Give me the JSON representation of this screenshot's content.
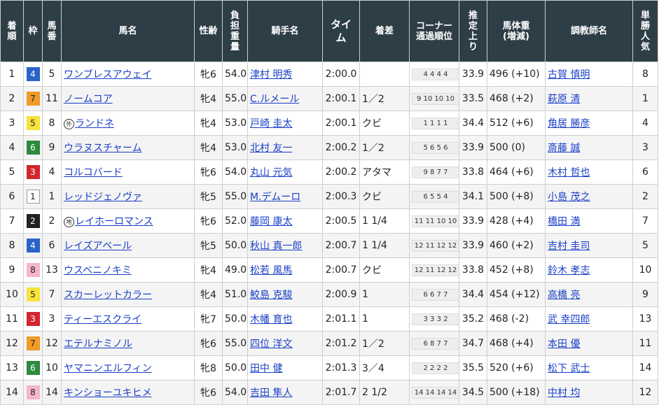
{
  "headers": {
    "rank": "着順",
    "waku": "枠",
    "umaban": "馬番",
    "horse": "馬名",
    "sexage": "性齢",
    "weight": "負担重量",
    "jockey": "騎手名",
    "time": "タイム",
    "margin": "着差",
    "corner": "コーナー通過順位",
    "last3f": "推定上り",
    "body": "馬体重(増減)",
    "trainer": "調教師名",
    "pop": "単勝人気"
  },
  "waku_colors": {
    "1": {
      "bg": "#ffffff",
      "fg": "#222222"
    },
    "2": {
      "bg": "#222222",
      "fg": "#ffffff"
    },
    "3": {
      "bg": "#d0262d",
      "fg": "#ffffff"
    },
    "4": {
      "bg": "#2a64c8",
      "fg": "#ffffff"
    },
    "5": {
      "bg": "#f6e33b",
      "fg": "#222222"
    },
    "6": {
      "bg": "#2e8a3e",
      "fg": "#ffffff"
    },
    "7": {
      "bg": "#f09a28",
      "fg": "#222222"
    },
    "8": {
      "bg": "#f6b6c8",
      "fg": "#222222"
    }
  },
  "rows": [
    {
      "rank": "1",
      "waku": "4",
      "umaban": "5",
      "mark": "",
      "horse": "ワンブレスアウェイ",
      "sexage": "牝6",
      "weight": "54.0",
      "jockey": "津村 明秀",
      "time": "2:00.0",
      "margin": "",
      "corner": "4 4 4 4",
      "last3f": "33.9",
      "body": "496 (+10)",
      "trainer": "古賀 慎明",
      "pop": "8"
    },
    {
      "rank": "2",
      "waku": "7",
      "umaban": "11",
      "mark": "",
      "horse": "ノームコア",
      "sexage": "牝4",
      "weight": "55.0",
      "jockey": "C.ルメール",
      "time": "2:00.1",
      "margin": "1／2",
      "corner": "9 10 10 10",
      "last3f": "33.5",
      "body": "468 (+2)",
      "trainer": "萩原 清",
      "pop": "1"
    },
    {
      "rank": "3",
      "waku": "5",
      "umaban": "8",
      "mark": "外",
      "horse": "ランドネ",
      "sexage": "牝4",
      "weight": "53.0",
      "jockey": "戸崎 圭太",
      "time": "2:00.1",
      "margin": "クビ",
      "corner": "1 1 1 1",
      "last3f": "34.4",
      "body": "512 (+6)",
      "trainer": "角居 勝彦",
      "pop": "4"
    },
    {
      "rank": "4",
      "waku": "6",
      "umaban": "9",
      "mark": "",
      "horse": "ウラヌスチャーム",
      "sexage": "牝4",
      "weight": "53.0",
      "jockey": "北村 友一",
      "time": "2:00.2",
      "margin": "1／2",
      "corner": "5 6 5 6",
      "last3f": "33.9",
      "body": "500 (0)",
      "trainer": "斎藤 誠",
      "pop": "3"
    },
    {
      "rank": "5",
      "waku": "3",
      "umaban": "4",
      "mark": "",
      "horse": "コルコバード",
      "sexage": "牝6",
      "weight": "54.0",
      "jockey": "丸山 元気",
      "time": "2:00.2",
      "margin": "アタマ",
      "corner": "9 8 7 7",
      "last3f": "33.8",
      "body": "464 (+6)",
      "trainer": "木村 哲也",
      "pop": "6"
    },
    {
      "rank": "6",
      "waku": "1",
      "umaban": "1",
      "mark": "",
      "horse": "レッドジェノヴァ",
      "sexage": "牝5",
      "weight": "55.0",
      "jockey": "M.デムーロ",
      "time": "2:00.3",
      "margin": "クビ",
      "corner": "6 5 5 4",
      "last3f": "34.1",
      "body": "500 (+8)",
      "trainer": "小島 茂之",
      "pop": "2"
    },
    {
      "rank": "7",
      "waku": "2",
      "umaban": "2",
      "mark": "地",
      "horse": "レイホーロマンス",
      "sexage": "牝6",
      "weight": "52.0",
      "jockey": "藤岡 康太",
      "time": "2:00.5",
      "margin": "1 1/4",
      "corner": "11 11 10 10",
      "last3f": "33.9",
      "body": "428 (+4)",
      "trainer": "橋田 満",
      "pop": "7"
    },
    {
      "rank": "8",
      "waku": "4",
      "umaban": "6",
      "mark": "",
      "horse": "レイズアベール",
      "sexage": "牝5",
      "weight": "50.0",
      "jockey": "秋山 真一郎",
      "time": "2:00.7",
      "margin": "1 1/4",
      "corner": "12 11 12 12",
      "last3f": "33.9",
      "body": "460 (+2)",
      "trainer": "吉村 圭司",
      "pop": "5"
    },
    {
      "rank": "9",
      "waku": "8",
      "umaban": "13",
      "mark": "",
      "horse": "ウスベニノキミ",
      "sexage": "牝4",
      "weight": "49.0",
      "jockey": "松若 風馬",
      "time": "2:00.7",
      "margin": "クビ",
      "corner": "12 11 12 12",
      "last3f": "33.8",
      "body": "452 (+8)",
      "trainer": "鈴木 孝志",
      "pop": "10"
    },
    {
      "rank": "10",
      "waku": "5",
      "umaban": "7",
      "mark": "",
      "horse": "スカーレットカラー",
      "sexage": "牝4",
      "weight": "51.0",
      "jockey": "鮫島 克駿",
      "time": "2:00.9",
      "margin": "1",
      "corner": "6 6 7 7",
      "last3f": "34.4",
      "body": "454 (+12)",
      "trainer": "高橋 亮",
      "pop": "9"
    },
    {
      "rank": "11",
      "waku": "3",
      "umaban": "3",
      "mark": "",
      "horse": "ティーエスクライ",
      "sexage": "牝7",
      "weight": "50.0",
      "jockey": "木幡 育也",
      "time": "2:01.1",
      "margin": "1",
      "corner": "3 3 3 2",
      "last3f": "35.2",
      "body": "468 (-2)",
      "trainer": "武 幸四郎",
      "pop": "13"
    },
    {
      "rank": "12",
      "waku": "7",
      "umaban": "12",
      "mark": "",
      "horse": "エテルナミノル",
      "sexage": "牝6",
      "weight": "55.0",
      "jockey": "四位 洋文",
      "time": "2:01.2",
      "margin": "1／2",
      "corner": "6 8 7 7",
      "last3f": "34.7",
      "body": "468 (+4)",
      "trainer": "本田 優",
      "pop": "11"
    },
    {
      "rank": "13",
      "waku": "6",
      "umaban": "10",
      "mark": "",
      "horse": "ヤマニンエルフィン",
      "sexage": "牝8",
      "weight": "50.0",
      "jockey": "田中 健",
      "time": "2:01.3",
      "margin": "3／4",
      "corner": "2 2 2 2",
      "last3f": "35.5",
      "body": "520 (+6)",
      "trainer": "松下 武士",
      "pop": "14"
    },
    {
      "rank": "14",
      "waku": "8",
      "umaban": "14",
      "mark": "",
      "horse": "キンショーユキヒメ",
      "sexage": "牝6",
      "weight": "54.0",
      "jockey": "吉田 隼人",
      "time": "2:01.7",
      "margin": "2 1/2",
      "corner": "14 14 14 14",
      "last3f": "34.5",
      "body": "500 (+18)",
      "trainer": "中村 均",
      "pop": "12"
    }
  ]
}
